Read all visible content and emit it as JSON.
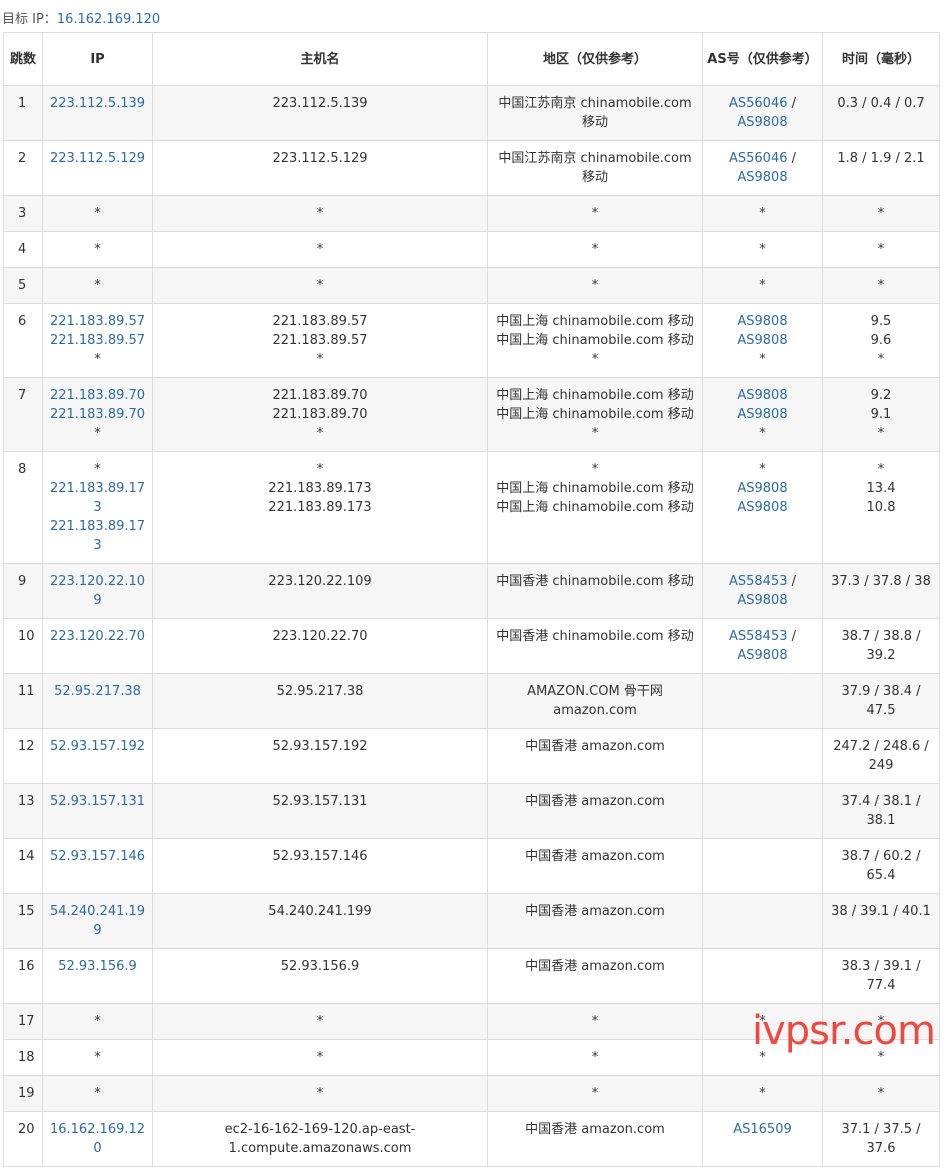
{
  "target": {
    "label": "目标 IP：",
    "ip": "16.162.169.120"
  },
  "headers": [
    "跳数",
    "IP",
    "主机名",
    "地区（仅供参考）",
    "AS号（仅供参考）",
    "时间（毫秒）"
  ],
  "rows": [
    {
      "hop": "1",
      "ip": [
        "223.112.5.139"
      ],
      "host": [
        "223.112.5.139"
      ],
      "region": [
        "中国江苏南京 chinamobile.com 移动"
      ],
      "asn": [
        [
          "AS56046",
          "AS9808"
        ]
      ],
      "time": [
        "0.3 / 0.4 / 0.7"
      ]
    },
    {
      "hop": "2",
      "ip": [
        "223.112.5.129"
      ],
      "host": [
        "223.112.5.129"
      ],
      "region": [
        "中国江苏南京 chinamobile.com 移动"
      ],
      "asn": [
        [
          "AS56046",
          "AS9808"
        ]
      ],
      "time": [
        "1.8 / 1.9 / 2.1"
      ]
    },
    {
      "hop": "3",
      "ip": [
        "*"
      ],
      "host": [
        "*"
      ],
      "region": [
        "*"
      ],
      "asn": [
        "*"
      ],
      "time": [
        "*"
      ]
    },
    {
      "hop": "4",
      "ip": [
        "*"
      ],
      "host": [
        "*"
      ],
      "region": [
        "*"
      ],
      "asn": [
        "*"
      ],
      "time": [
        "*"
      ]
    },
    {
      "hop": "5",
      "ip": [
        "*"
      ],
      "host": [
        "*"
      ],
      "region": [
        "*"
      ],
      "asn": [
        "*"
      ],
      "time": [
        "*"
      ]
    },
    {
      "hop": "6",
      "ip": [
        "221.183.89.57",
        "221.183.89.57",
        "*"
      ],
      "host": [
        "221.183.89.57",
        "221.183.89.57",
        "*"
      ],
      "region": [
        "中国上海 chinamobile.com 移动",
        "中国上海 chinamobile.com 移动",
        "*"
      ],
      "asn": [
        [
          "AS9808"
        ],
        [
          "AS9808"
        ],
        "*"
      ],
      "time": [
        "9.5",
        "9.6",
        "*"
      ]
    },
    {
      "hop": "7",
      "ip": [
        "221.183.89.70",
        "221.183.89.70",
        "*"
      ],
      "host": [
        "221.183.89.70",
        "221.183.89.70",
        "*"
      ],
      "region": [
        "中国上海 chinamobile.com 移动",
        "中国上海 chinamobile.com 移动",
        "*"
      ],
      "asn": [
        [
          "AS9808"
        ],
        [
          "AS9808"
        ],
        "*"
      ],
      "time": [
        "9.2",
        "9.1",
        "*"
      ]
    },
    {
      "hop": "8",
      "ip": [
        "*",
        "221.183.89.173",
        "221.183.89.173"
      ],
      "host": [
        "*",
        "221.183.89.173",
        "221.183.89.173"
      ],
      "region": [
        "*",
        "中国上海 chinamobile.com 移动",
        "中国上海 chinamobile.com 移动"
      ],
      "asn": [
        "*",
        [
          "AS9808"
        ],
        [
          "AS9808"
        ]
      ],
      "time": [
        "*",
        "13.4",
        "10.8"
      ]
    },
    {
      "hop": "9",
      "ip": [
        "223.120.22.109"
      ],
      "host": [
        "223.120.22.109"
      ],
      "region": [
        "中国香港 chinamobile.com 移动"
      ],
      "asn": [
        [
          "AS58453",
          "AS9808"
        ]
      ],
      "time": [
        "37.3 / 37.8 / 38"
      ]
    },
    {
      "hop": "10",
      "ip": [
        "223.120.22.70"
      ],
      "host": [
        "223.120.22.70"
      ],
      "region": [
        "中国香港 chinamobile.com 移动"
      ],
      "asn": [
        [
          "AS58453",
          "AS9808"
        ]
      ],
      "time": [
        "38.7 / 38.8 / 39.2"
      ]
    },
    {
      "hop": "11",
      "ip": [
        "52.95.217.38"
      ],
      "host": [
        "52.95.217.38"
      ],
      "region": [
        "AMAZON.COM 骨干网 amazon.com"
      ],
      "asn": [
        ""
      ],
      "time": [
        "37.9 / 38.4 / 47.5"
      ]
    },
    {
      "hop": "12",
      "ip": [
        "52.93.157.192"
      ],
      "host": [
        "52.93.157.192"
      ],
      "region": [
        "中国香港 amazon.com"
      ],
      "asn": [
        ""
      ],
      "time": [
        "247.2 / 248.6 / 249"
      ]
    },
    {
      "hop": "13",
      "ip": [
        "52.93.157.131"
      ],
      "host": [
        "52.93.157.131"
      ],
      "region": [
        "中国香港 amazon.com"
      ],
      "asn": [
        ""
      ],
      "time": [
        "37.4 / 38.1 / 38.1"
      ]
    },
    {
      "hop": "14",
      "ip": [
        "52.93.157.146"
      ],
      "host": [
        "52.93.157.146"
      ],
      "region": [
        "中国香港 amazon.com"
      ],
      "asn": [
        ""
      ],
      "time": [
        "38.7 / 60.2 / 65.4"
      ]
    },
    {
      "hop": "15",
      "ip": [
        "54.240.241.199"
      ],
      "host": [
        "54.240.241.199"
      ],
      "region": [
        "中国香港 amazon.com"
      ],
      "asn": [
        ""
      ],
      "time": [
        "38 / 39.1 / 40.1"
      ]
    },
    {
      "hop": "16",
      "ip": [
        "52.93.156.9"
      ],
      "host": [
        "52.93.156.9"
      ],
      "region": [
        "中国香港 amazon.com"
      ],
      "asn": [
        ""
      ],
      "time": [
        "38.3 / 39.1 / 77.4"
      ]
    },
    {
      "hop": "17",
      "ip": [
        "*"
      ],
      "host": [
        "*"
      ],
      "region": [
        "*"
      ],
      "asn": [
        "*"
      ],
      "time": [
        "*"
      ]
    },
    {
      "hop": "18",
      "ip": [
        "*"
      ],
      "host": [
        "*"
      ],
      "region": [
        "*"
      ],
      "asn": [
        "*"
      ],
      "time": [
        "*"
      ]
    },
    {
      "hop": "19",
      "ip": [
        "*"
      ],
      "host": [
        "*"
      ],
      "region": [
        "*"
      ],
      "asn": [
        "*"
      ],
      "time": [
        "*"
      ]
    },
    {
      "hop": "20",
      "ip": [
        "16.162.169.120"
      ],
      "host": [
        "ec2-16-162-169-120.ap-east-1.compute.amazonaws.com"
      ],
      "region": [
        "中国香港 amazon.com"
      ],
      "asn": [
        [
          "AS16509"
        ]
      ],
      "time": [
        "37.1 / 37.5 / 37.6"
      ]
    }
  ],
  "watermark": "ivpsr.com",
  "colors": {
    "link": "#2d6aa8",
    "stripe": "#f6f6f6",
    "border": "#dddddd",
    "watermark": "#ee281e"
  }
}
